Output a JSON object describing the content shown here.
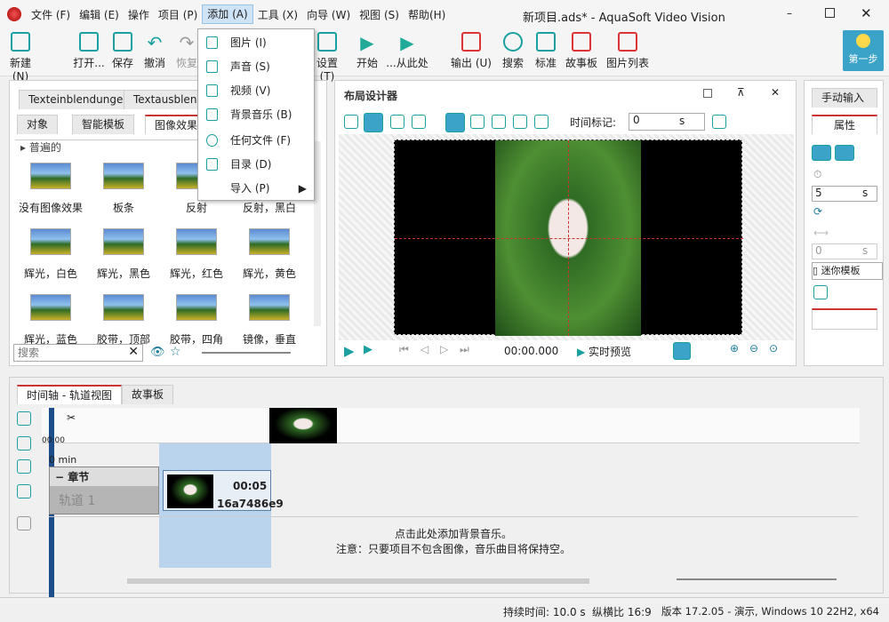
{
  "window": {
    "title": "新项目.ads* - AquaSoft Video Vision"
  },
  "menu": [
    "文件 (F)",
    "编辑 (E)",
    "操作",
    "项目 (P)",
    "添加 (A)",
    "工具 (X)",
    "向导 (W)",
    "视图 (S)",
    "帮助(H)"
  ],
  "toolbar": {
    "new": "新建 (N)",
    "open": "打开...",
    "save": "保存",
    "undo": "撤消",
    "redo": "恢复",
    "settings": "设置 (T)",
    "start": "开始",
    "from_here": "...从此处",
    "output": "输出 (U)",
    "search": "搜索",
    "standard": "标准",
    "storyboard": "故事板",
    "image_list": "图片列表",
    "first_step": "第一步"
  },
  "add_menu": {
    "items": [
      "图片 (I)",
      "声音 (S)",
      "视频 (V)",
      "背景音乐 (B)",
      "任何文件 (F)",
      "目录 (D)",
      "导入 (P)"
    ]
  },
  "left_panel": {
    "tabs_top": [
      "Texteinblendungen",
      "Textausblendu..."
    ],
    "tabs": [
      "对象",
      "智能模板",
      "图像效果"
    ],
    "section": "普遍的",
    "effects": [
      "没有图像效果",
      "板条",
      "反射",
      "反射，黑白",
      "辉光，白色",
      "辉光，黑色",
      "辉光，红色",
      "辉光，黄色",
      "辉光，蓝色",
      "胶带，顶部",
      "胶带，四角",
      "镜像，垂直"
    ],
    "search_placeholder": "搜索"
  },
  "designer": {
    "title": "布局设计器",
    "time_label": "时间标记:",
    "time_value": "0",
    "time_unit": "s",
    "time_display": "00:00.000",
    "live_preview": "实时预览"
  },
  "right_panel": {
    "manual": "手动输入",
    "props": "属性",
    "duration": "5",
    "unit": "s",
    "zero": "0",
    "mini_template": "迷你模板"
  },
  "timeline": {
    "tabs": [
      "时间轴 - 轨道视图",
      "故事板"
    ],
    "time0": "00:00",
    "min0": "0 min",
    "chapter": "章节",
    "track": "轨道 1",
    "clip_time": "00:05",
    "clip_name": "16a7486e9",
    "music_hint1": "点击此处添加背景音乐。",
    "music_hint2": "注意：只要项目不包含图像，音乐曲目将保持空。"
  },
  "status": {
    "duration": "持续时间: 10.0 s",
    "aspect": "纵横比 16:9",
    "version": "版本 17.2.05 - 演示, Windows 10 22H2, x64"
  }
}
